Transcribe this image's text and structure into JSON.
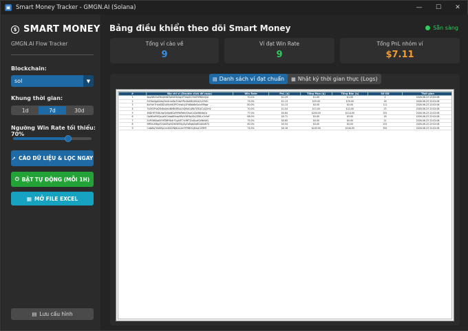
{
  "window": {
    "title": "Smart Money Tracker - GMGN.AI (Solana)",
    "controls": [
      "—",
      "☐",
      "✕"
    ]
  },
  "sidebar": {
    "logo": "SMART MONEY",
    "subtitle": "GMGN.AI Flow Tracker",
    "blockchain_label": "Blockchain:",
    "blockchain_value": "sol",
    "timeframe_label": "Khung thời gian:",
    "timeframes": [
      "1d",
      "7d",
      "30d"
    ],
    "timeframe_selected": "7d",
    "winrate_label": "Ngưỡng Win Rate tối thiểu: 70%",
    "winrate_slider": {
      "min": 0,
      "max": 100,
      "value": 70
    },
    "btn_scrape": "CÀO DỮ LIỆU & LỌC NGAY",
    "btn_auto": "BẬT TỰ ĐỘNG (MỖI 1H)",
    "btn_excel": "MỞ FILE EXCEL",
    "btn_save": "Lưu cấu hình"
  },
  "main": {
    "title": "Bảng điều khiển theo dõi Smart Money",
    "status": "Sẵn sàng",
    "cards": [
      {
        "label": "Tổng ví cào về",
        "value": "9",
        "color": "#3b8ee0"
      },
      {
        "label": "Ví đạt Win Rate",
        "value": "9",
        "color": "#2fcc5b"
      },
      {
        "label": "Tổng PnL nhóm ví",
        "value": "$7.11",
        "color": "#f39c34"
      }
    ],
    "tabs": [
      "Danh sách ví đạt chuẩn",
      "Nhật ký thời gian thực (Logs)"
    ],
    "tab_active": 0
  },
  "table": {
    "columns": [
      "#",
      "Địa chỉ ví (Double click để copy)",
      "Win Rate",
      "PnL ($)",
      "Tổng Mua ($)",
      "Tổng Bán ($)",
      "Số GD",
      "Thời gian"
    ],
    "rows": [
      [
        "1",
        "6pyNHrXxZHsQmkE3pNrZ4VkqcFTmpGG7ahYhP8XnSJ4r",
        "70.2%",
        "$1.29",
        "$1.00",
        "$1.00",
        "2",
        "2026-06-23 22:02:08"
      ],
      [
        "2",
        "FrZHwQgA2dwj3mXcrwDq7HdvYRcXkzMtUk9Ux2c1PzEr",
        "75.0%",
        "$1.13",
        "$25.00",
        "$70.00",
        "18",
        "2026-06-23 22:02:08"
      ],
      [
        "3",
        "8uiYxh7HvbS8ZuX9yhHJ3PChnwUy2Fd6ab6eSxvnM9gw",
        "80.0%",
        "$1.13",
        "$0.00",
        "$0.00",
        "111",
        "2026-06-23 22:02:08"
      ],
      [
        "4",
        "7eZK5P4d2Kr6wAmsNM8rSRkzLhQMaCsWb7t3DcCuQ2mV",
        "70.0%",
        "$1.04",
        "$11.00",
        "$12.00",
        "23",
        "2026-06-23 22:02:08"
      ],
      [
        "5",
        "4BDrYEfTu8L9wQs9JpNGaFMYaPe8v5XvaCcDoH6k8qCp",
        "77.0%",
        "$0.84",
        "$204.00",
        "$214.00",
        "251",
        "2026-06-23 22:02:08"
      ],
      [
        "6",
        "Gp9KiaMUQpLaW1Vwq8NnxoRAVh3tF6a4Gs2ZWLx7nVeF",
        "66.0%",
        "$0.71",
        "$5.00",
        "$5.00",
        "16",
        "2026-06-23 22:02:08"
      ],
      [
        "7",
        "2UPLTcBAs6XYXPJMYW4rF1gA9T7cHRT32xDuafQrWdWQ",
        "75.0%",
        "$0.65",
        "$0.00",
        "$0.00",
        "21",
        "2026-06-23 22:02:08"
      ],
      [
        "8",
        "9MfVuXMgdTzQbSFqzVDtUWENyj4yZaRqbJSqRGdAhW7U",
        "60.0%",
        "$0.54",
        "$0.00",
        "$0.00",
        "201",
        "2026-06-23 22:02:08"
      ],
      [
        "9",
        "CdbWq7rNAfSp1m4D2ZNj6LtLUmYFP8K3LJ84vjC2EMTi",
        "74.0%",
        "$0.16",
        "$243.00",
        "$240.00",
        "591",
        "2026-06-23 22:02:08"
      ]
    ]
  }
}
